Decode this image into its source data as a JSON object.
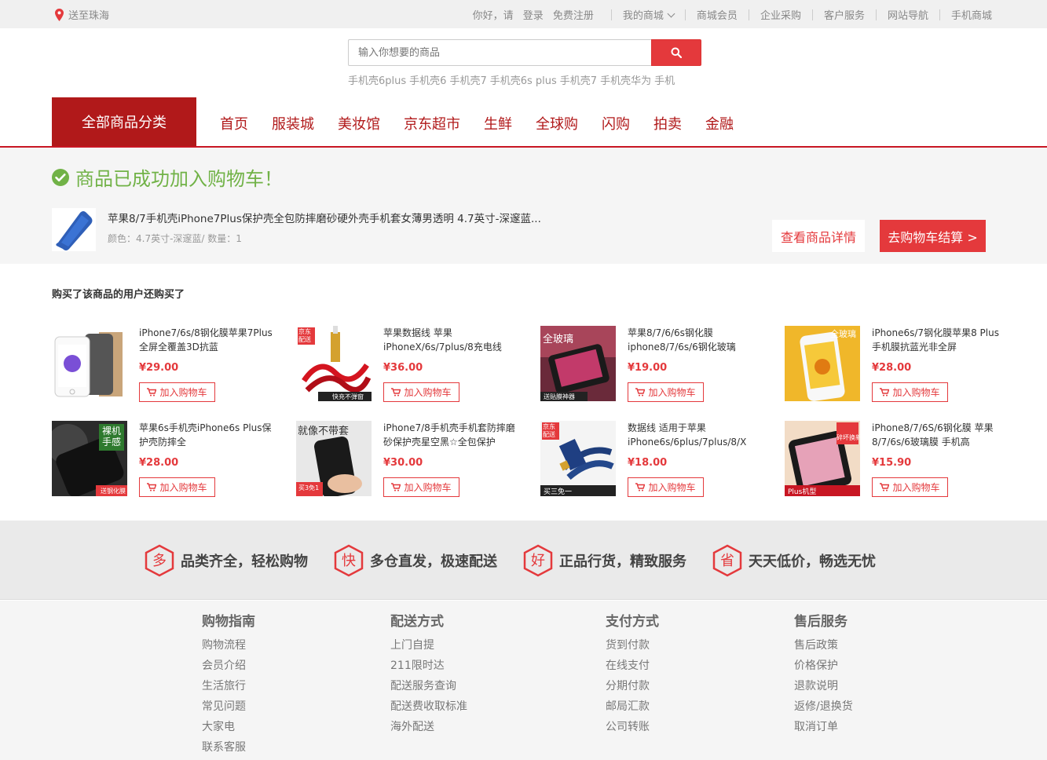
{
  "topbar": {
    "location": "送至珠海",
    "greeting": "你好，请",
    "login": "登录",
    "register": "免费注册",
    "my_mall": "我的商城",
    "links": [
      "商城会员",
      "企业采购",
      "客户服务",
      "网站导航",
      "手机商城"
    ]
  },
  "search": {
    "placeholder": "输入你想要的商品",
    "hotwords": [
      "手机壳6plus",
      "手机壳6",
      "手机壳7",
      "手机壳6s plus",
      "手机壳7",
      "手机壳华为",
      "手机"
    ]
  },
  "nav": {
    "all_categories": "全部商品分类",
    "items": [
      "首页",
      "服装城",
      "美妆馆",
      "京东超市",
      "生鲜",
      "全球购",
      "闪购",
      "拍卖",
      "金融"
    ]
  },
  "success": {
    "title": "商品已成功加入购物车！",
    "product_title": "苹果8/7手机壳iPhone7Plus保护壳全包防摔磨砂硬外壳手机套女薄男透明 4.7英寸-深邃蓝...",
    "product_meta": "颜色：4.7英寸-深邃蓝/ 数量：1",
    "view_detail": "查看商品详情",
    "checkout": "去购物车结算 >"
  },
  "recommend": {
    "title": "购买了该商品的用户还购买了",
    "add_label": "加入购物车",
    "products": [
      {
        "name": "iPhone7/6s/8钢化膜苹果7Plus全屏全覆盖3D抗蓝",
        "price": "¥29.00"
      },
      {
        "name": "苹果数据线 苹果iPhoneX/6s/7plus/8充电线",
        "price": "¥36.00",
        "badge": "京东配送",
        "tag": "快充不弹窗"
      },
      {
        "name": "苹果8/7/6/6s钢化膜iphone8/7/6s/6钢化玻璃",
        "price": "¥19.00",
        "badge": "全玻璃",
        "tag": "送贴膜神器"
      },
      {
        "name": "iPhone6s/7钢化膜苹果8 Plus手机膜抗蓝光非全屏",
        "price": "¥28.00",
        "badge": "全玻璃"
      },
      {
        "name": "苹果6s手机壳iPhone6s Plus保护壳防摔全",
        "price": "¥28.00",
        "badge": "裸机手感",
        "tag": "送钢化膜"
      },
      {
        "name": "iPhone7/8手机壳手机套防摔磨砂保护壳星空黑☆全包保护",
        "price": "¥30.00",
        "badge": "就像不带套",
        "tag": "买3免1"
      },
      {
        "name": "数据线 适用于苹果iPhone6s/6plus/7plus/8/X",
        "price": "¥18.00",
        "badge": "京东配送",
        "tag": "买三免一"
      },
      {
        "name": "iPhone8/7/6S/6钢化膜 苹果8/7/6s/6玻璃膜 手机高",
        "price": "¥15.90",
        "badge": "碎坏换新",
        "tag": "Plus机型"
      }
    ]
  },
  "promises": [
    {
      "char": "多",
      "label": "品类齐全，轻松购物"
    },
    {
      "char": "快",
      "label": "多仓直发，极速配送"
    },
    {
      "char": "好",
      "label": "正品行货，精致服务"
    },
    {
      "char": "省",
      "label": "天天低价，畅选无忧"
    }
  ],
  "footer": [
    {
      "title": "购物指南",
      "links": [
        "购物流程",
        "会员介绍",
        "生活旅行",
        "常见问题",
        "大家电",
        "联系客服"
      ]
    },
    {
      "title": "配送方式",
      "links": [
        "上门自提",
        "211限时达",
        "配送服务查询",
        "配送费收取标准",
        "海外配送"
      ]
    },
    {
      "title": "支付方式",
      "links": [
        "货到付款",
        "在线支付",
        "分期付款",
        "邮局汇款",
        "公司转账"
      ]
    },
    {
      "title": "售后服务",
      "links": [
        "售后政策",
        "价格保护",
        "退款说明",
        "返修/退换货",
        "取消订单"
      ]
    }
  ],
  "colors": {
    "brand_red": "#e4393c",
    "nav_red": "#b1191a",
    "success_green": "#71b247"
  }
}
